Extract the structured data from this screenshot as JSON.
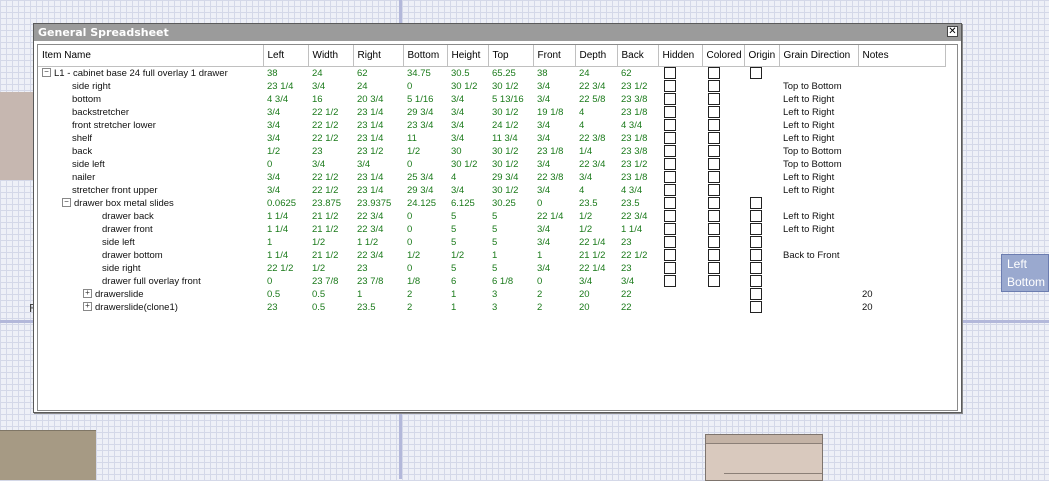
{
  "window": {
    "title": "General Spreadsheet",
    "close_glyph": "✕"
  },
  "background": {
    "side_label_line1": "Left",
    "side_label_line2": "Bottom",
    "left_char": "F"
  },
  "columns": [
    "Item Name",
    "Left",
    "Width",
    "Right",
    "Bottom",
    "Height",
    "Top",
    "Front",
    "Depth",
    "Back",
    "Hidden",
    "Colored",
    "Origin",
    "Grain Direction",
    "Notes"
  ],
  "rows": [
    {
      "name": "L1 - cabinet base 24 full overlay 1 drawer",
      "level": 0,
      "toggle": "−",
      "left": "38",
      "width": "24",
      "right": "62",
      "bottom": "34.75",
      "height": "30.5",
      "top": "65.25",
      "front": "38",
      "depth": "24",
      "back": "62",
      "hidden": true,
      "colored": true,
      "origin": true,
      "grain": "",
      "notes": ""
    },
    {
      "name": "side right",
      "level": 1,
      "toggle": "",
      "left": "23 1/4",
      "width": "3/4",
      "right": "24",
      "bottom": "0",
      "height": "30 1/2",
      "top": "30 1/2",
      "front": "3/4",
      "depth": "22 3/4",
      "back": "23 1/2",
      "hidden": true,
      "colored": true,
      "origin": false,
      "grain": "Top to Bottom",
      "notes": ""
    },
    {
      "name": "bottom",
      "level": 1,
      "toggle": "",
      "left": "4 3/4",
      "width": "16",
      "right": "20 3/4",
      "bottom": "5 1/16",
      "height": "3/4",
      "top": "5 13/16",
      "front": "3/4",
      "depth": "22 5/8",
      "back": "23 3/8",
      "hidden": true,
      "colored": true,
      "origin": false,
      "grain": "Left to Right",
      "notes": ""
    },
    {
      "name": "backstretcher",
      "level": 1,
      "toggle": "",
      "left": "3/4",
      "width": "22 1/2",
      "right": "23 1/4",
      "bottom": "29 3/4",
      "height": "3/4",
      "top": "30 1/2",
      "front": "19 1/8",
      "depth": "4",
      "back": "23 1/8",
      "hidden": true,
      "colored": true,
      "origin": false,
      "grain": "Left to Right",
      "notes": ""
    },
    {
      "name": "front stretcher lower",
      "level": 1,
      "toggle": "",
      "left": "3/4",
      "width": "22 1/2",
      "right": "23 1/4",
      "bottom": "23 3/4",
      "height": "3/4",
      "top": "24 1/2",
      "front": "3/4",
      "depth": "4",
      "back": "4 3/4",
      "hidden": true,
      "colored": true,
      "origin": false,
      "grain": "Left to Right",
      "notes": ""
    },
    {
      "name": "shelf",
      "level": 1,
      "toggle": "",
      "left": "3/4",
      "width": "22 1/2",
      "right": "23 1/4",
      "bottom": "11",
      "height": "3/4",
      "top": "11 3/4",
      "front": "3/4",
      "depth": "22 3/8",
      "back": "23 1/8",
      "hidden": true,
      "colored": true,
      "origin": false,
      "grain": "Left to Right",
      "notes": ""
    },
    {
      "name": "back",
      "level": 1,
      "toggle": "",
      "left": "1/2",
      "width": "23",
      "right": "23 1/2",
      "bottom": "1/2",
      "height": "30",
      "top": "30 1/2",
      "front": "23 1/8",
      "depth": "1/4",
      "back": "23 3/8",
      "hidden": true,
      "colored": true,
      "origin": false,
      "grain": "Top to Bottom",
      "notes": ""
    },
    {
      "name": "side left",
      "level": 1,
      "toggle": "",
      "left": "0",
      "width": "3/4",
      "right": "3/4",
      "bottom": "0",
      "height": "30 1/2",
      "top": "30 1/2",
      "front": "3/4",
      "depth": "22 3/4",
      "back": "23 1/2",
      "hidden": true,
      "colored": true,
      "origin": false,
      "grain": "Top to Bottom",
      "notes": ""
    },
    {
      "name": "nailer",
      "level": 1,
      "toggle": "",
      "left": "3/4",
      "width": "22 1/2",
      "right": "23 1/4",
      "bottom": "25 3/4",
      "height": "4",
      "top": "29 3/4",
      "front": "22 3/8",
      "depth": "3/4",
      "back": "23 1/8",
      "hidden": true,
      "colored": true,
      "origin": false,
      "grain": "Left to Right",
      "notes": ""
    },
    {
      "name": "stretcher front upper",
      "level": 1,
      "toggle": "",
      "left": "3/4",
      "width": "22 1/2",
      "right": "23 1/4",
      "bottom": "29 3/4",
      "height": "3/4",
      "top": "30 1/2",
      "front": "3/4",
      "depth": "4",
      "back": "4 3/4",
      "hidden": true,
      "colored": true,
      "origin": false,
      "grain": "Left to Right",
      "notes": ""
    },
    {
      "name": "drawer box metal slides",
      "level": 1,
      "toggle": "−",
      "left": "0.0625",
      "width": "23.875",
      "right": "23.9375",
      "bottom": "24.125",
      "height": "6.125",
      "top": "30.25",
      "front": "0",
      "depth": "23.5",
      "back": "23.5",
      "hidden": true,
      "colored": true,
      "origin": true,
      "grain": "",
      "notes": ""
    },
    {
      "name": "drawer back",
      "level": 2,
      "toggle": "",
      "left": "1 1/4",
      "width": "21 1/2",
      "right": "22 3/4",
      "bottom": "0",
      "height": "5",
      "top": "5",
      "front": "22 1/4",
      "depth": "1/2",
      "back": "22 3/4",
      "hidden": true,
      "colored": true,
      "origin": true,
      "grain": "Left to Right",
      "notes": ""
    },
    {
      "name": "drawer front",
      "level": 2,
      "toggle": "",
      "left": "1 1/4",
      "width": "21 1/2",
      "right": "22 3/4",
      "bottom": "0",
      "height": "5",
      "top": "5",
      "front": "3/4",
      "depth": "1/2",
      "back": "1 1/4",
      "hidden": true,
      "colored": true,
      "origin": true,
      "grain": "Left to Right",
      "notes": ""
    },
    {
      "name": "side left",
      "level": 2,
      "toggle": "",
      "left": "1",
      "width": "1/2",
      "right": "1 1/2",
      "bottom": "0",
      "height": "5",
      "top": "5",
      "front": "3/4",
      "depth": "22 1/4",
      "back": "23",
      "hidden": true,
      "colored": true,
      "origin": true,
      "grain": "",
      "notes": ""
    },
    {
      "name": "drawer bottom",
      "level": 2,
      "toggle": "",
      "left": "1 1/4",
      "width": "21 1/2",
      "right": "22 3/4",
      "bottom": "1/2",
      "height": "1/2",
      "top": "1",
      "front": "1",
      "depth": "21 1/2",
      "back": "22 1/2",
      "hidden": true,
      "colored": true,
      "origin": true,
      "grain": "Back to Front",
      "notes": ""
    },
    {
      "name": "side right",
      "level": 2,
      "toggle": "",
      "left": "22 1/2",
      "width": "1/2",
      "right": "23",
      "bottom": "0",
      "height": "5",
      "top": "5",
      "front": "3/4",
      "depth": "22 1/4",
      "back": "23",
      "hidden": true,
      "colored": true,
      "origin": true,
      "grain": "",
      "notes": ""
    },
    {
      "name": "drawer full overlay front",
      "level": 2,
      "toggle": "",
      "left": "0",
      "width": "23 7/8",
      "right": "23 7/8",
      "bottom": "1/8",
      "height": "6",
      "top": "6 1/8",
      "front": "0",
      "depth": "3/4",
      "back": "3/4",
      "hidden": true,
      "colored": true,
      "origin": true,
      "grain": "",
      "notes": ""
    },
    {
      "name": "drawerslide",
      "level": 2,
      "toggle": "+",
      "left": "0.5",
      "width": "0.5",
      "right": "1",
      "bottom": "2",
      "height": "1",
      "top": "3",
      "front": "2",
      "depth": "20",
      "back": "22",
      "hidden": false,
      "colored": false,
      "origin": true,
      "grain": "",
      "notes": "20"
    },
    {
      "name": "drawerslide(clone1)",
      "level": 2,
      "toggle": "+",
      "left": "23",
      "width": "0.5",
      "right": "23.5",
      "bottom": "2",
      "height": "1",
      "top": "3",
      "front": "2",
      "depth": "20",
      "back": "22",
      "hidden": false,
      "colored": false,
      "origin": true,
      "grain": "",
      "notes": "20"
    }
  ]
}
